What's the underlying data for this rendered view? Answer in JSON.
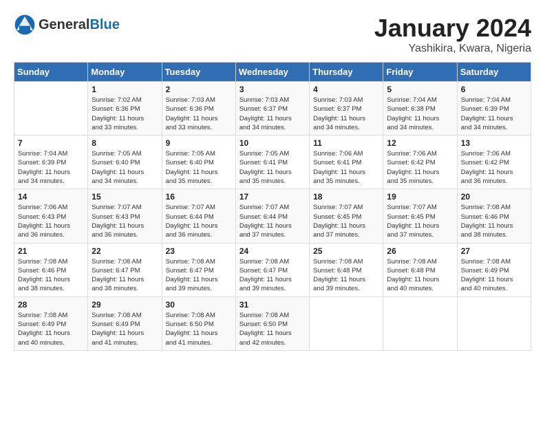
{
  "logo": {
    "text_general": "General",
    "text_blue": "Blue"
  },
  "title": "January 2024",
  "subtitle": "Yashikira, Kwara, Nigeria",
  "days_of_week": [
    "Sunday",
    "Monday",
    "Tuesday",
    "Wednesday",
    "Thursday",
    "Friday",
    "Saturday"
  ],
  "weeks": [
    [
      {
        "num": "",
        "detail": ""
      },
      {
        "num": "1",
        "detail": "Sunrise: 7:02 AM\nSunset: 6:36 PM\nDaylight: 11 hours\nand 33 minutes."
      },
      {
        "num": "2",
        "detail": "Sunrise: 7:03 AM\nSunset: 6:36 PM\nDaylight: 11 hours\nand 33 minutes."
      },
      {
        "num": "3",
        "detail": "Sunrise: 7:03 AM\nSunset: 6:37 PM\nDaylight: 11 hours\nand 34 minutes."
      },
      {
        "num": "4",
        "detail": "Sunrise: 7:03 AM\nSunset: 6:37 PM\nDaylight: 11 hours\nand 34 minutes."
      },
      {
        "num": "5",
        "detail": "Sunrise: 7:04 AM\nSunset: 6:38 PM\nDaylight: 11 hours\nand 34 minutes."
      },
      {
        "num": "6",
        "detail": "Sunrise: 7:04 AM\nSunset: 6:39 PM\nDaylight: 11 hours\nand 34 minutes."
      }
    ],
    [
      {
        "num": "7",
        "detail": "Sunrise: 7:04 AM\nSunset: 6:39 PM\nDaylight: 11 hours\nand 34 minutes."
      },
      {
        "num": "8",
        "detail": "Sunrise: 7:05 AM\nSunset: 6:40 PM\nDaylight: 11 hours\nand 34 minutes."
      },
      {
        "num": "9",
        "detail": "Sunrise: 7:05 AM\nSunset: 6:40 PM\nDaylight: 11 hours\nand 35 minutes."
      },
      {
        "num": "10",
        "detail": "Sunrise: 7:05 AM\nSunset: 6:41 PM\nDaylight: 11 hours\nand 35 minutes."
      },
      {
        "num": "11",
        "detail": "Sunrise: 7:06 AM\nSunset: 6:41 PM\nDaylight: 11 hours\nand 35 minutes."
      },
      {
        "num": "12",
        "detail": "Sunrise: 7:06 AM\nSunset: 6:42 PM\nDaylight: 11 hours\nand 35 minutes."
      },
      {
        "num": "13",
        "detail": "Sunrise: 7:06 AM\nSunset: 6:42 PM\nDaylight: 11 hours\nand 36 minutes."
      }
    ],
    [
      {
        "num": "14",
        "detail": "Sunrise: 7:06 AM\nSunset: 6:43 PM\nDaylight: 11 hours\nand 36 minutes."
      },
      {
        "num": "15",
        "detail": "Sunrise: 7:07 AM\nSunset: 6:43 PM\nDaylight: 11 hours\nand 36 minutes."
      },
      {
        "num": "16",
        "detail": "Sunrise: 7:07 AM\nSunset: 6:44 PM\nDaylight: 11 hours\nand 36 minutes."
      },
      {
        "num": "17",
        "detail": "Sunrise: 7:07 AM\nSunset: 6:44 PM\nDaylight: 11 hours\nand 37 minutes."
      },
      {
        "num": "18",
        "detail": "Sunrise: 7:07 AM\nSunset: 6:45 PM\nDaylight: 11 hours\nand 37 minutes."
      },
      {
        "num": "19",
        "detail": "Sunrise: 7:07 AM\nSunset: 6:45 PM\nDaylight: 11 hours\nand 37 minutes."
      },
      {
        "num": "20",
        "detail": "Sunrise: 7:08 AM\nSunset: 6:46 PM\nDaylight: 11 hours\nand 38 minutes."
      }
    ],
    [
      {
        "num": "21",
        "detail": "Sunrise: 7:08 AM\nSunset: 6:46 PM\nDaylight: 11 hours\nand 38 minutes."
      },
      {
        "num": "22",
        "detail": "Sunrise: 7:08 AM\nSunset: 6:47 PM\nDaylight: 11 hours\nand 38 minutes."
      },
      {
        "num": "23",
        "detail": "Sunrise: 7:08 AM\nSunset: 6:47 PM\nDaylight: 11 hours\nand 39 minutes."
      },
      {
        "num": "24",
        "detail": "Sunrise: 7:08 AM\nSunset: 6:47 PM\nDaylight: 11 hours\nand 39 minutes."
      },
      {
        "num": "25",
        "detail": "Sunrise: 7:08 AM\nSunset: 6:48 PM\nDaylight: 11 hours\nand 39 minutes."
      },
      {
        "num": "26",
        "detail": "Sunrise: 7:08 AM\nSunset: 6:48 PM\nDaylight: 11 hours\nand 40 minutes."
      },
      {
        "num": "27",
        "detail": "Sunrise: 7:08 AM\nSunset: 6:49 PM\nDaylight: 11 hours\nand 40 minutes."
      }
    ],
    [
      {
        "num": "28",
        "detail": "Sunrise: 7:08 AM\nSunset: 6:49 PM\nDaylight: 11 hours\nand 40 minutes."
      },
      {
        "num": "29",
        "detail": "Sunrise: 7:08 AM\nSunset: 6:49 PM\nDaylight: 11 hours\nand 41 minutes."
      },
      {
        "num": "30",
        "detail": "Sunrise: 7:08 AM\nSunset: 6:50 PM\nDaylight: 11 hours\nand 41 minutes."
      },
      {
        "num": "31",
        "detail": "Sunrise: 7:08 AM\nSunset: 6:50 PM\nDaylight: 11 hours\nand 42 minutes."
      },
      {
        "num": "",
        "detail": ""
      },
      {
        "num": "",
        "detail": ""
      },
      {
        "num": "",
        "detail": ""
      }
    ]
  ]
}
